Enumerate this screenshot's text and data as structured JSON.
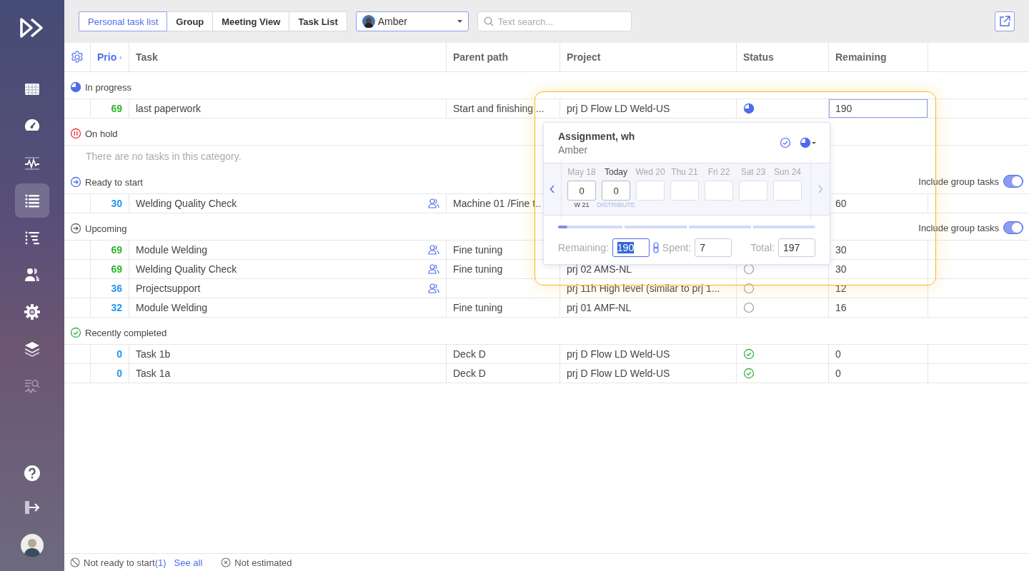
{
  "sidebar": {
    "items": [
      {
        "kind": "grid",
        "selected": false,
        "disabled": false
      },
      {
        "kind": "gauge",
        "selected": false,
        "disabled": false
      },
      {
        "kind": "pulse",
        "selected": false,
        "disabled": false
      },
      {
        "kind": "list",
        "selected": true,
        "disabled": false
      },
      {
        "kind": "tree",
        "selected": false,
        "disabled": false
      },
      {
        "kind": "people",
        "selected": false,
        "disabled": false
      },
      {
        "kind": "gear",
        "selected": false,
        "disabled": false
      },
      {
        "kind": "layers",
        "selected": false,
        "disabled": false
      },
      {
        "kind": "search_pulse",
        "selected": false,
        "disabled": true
      }
    ],
    "bottom_items": [
      {
        "kind": "help"
      },
      {
        "kind": "logout"
      },
      {
        "kind": "avatar"
      }
    ]
  },
  "toolbar": {
    "tabs": [
      {
        "label": "Personal task list",
        "selected": true
      },
      {
        "label": "Group",
        "selected": false
      },
      {
        "label": "Meeting View",
        "selected": false
      },
      {
        "label": "Task List",
        "selected": false
      }
    ],
    "user_select": {
      "value": "Amber"
    },
    "search": {
      "placeholder": "Text search..."
    }
  },
  "table": {
    "columns": [
      {
        "label": "Prio",
        "sorted": true
      },
      {
        "label": "Task",
        "sorted": false
      },
      {
        "label": "Parent path",
        "sorted": false
      },
      {
        "label": "Project",
        "sorted": false
      },
      {
        "label": "Status",
        "sorted": false
      },
      {
        "label": "Remaining",
        "sorted": false
      }
    ],
    "groups": [
      {
        "kind": "in_progress",
        "title": "In progress",
        "rows": [
          {
            "prio": "69",
            "color": "#2db52d",
            "task": "last paperwork",
            "group_task": false,
            "parent_path": "Start and finishing ...",
            "project": "prj D Flow LD Weld-US",
            "kind": "in_progress",
            "remaining": "190",
            "editing": true
          }
        ]
      },
      {
        "kind": "on_hold",
        "title": "On hold",
        "empty_text": "There are no tasks in this category."
      },
      {
        "kind": "ready",
        "title": "Ready to start",
        "toggle": {
          "label": "Include group tasks",
          "on": true
        },
        "rows": [
          {
            "prio": "30",
            "color": "#2196f3",
            "task": "Welding Quality Check",
            "group_task": true,
            "parent_path": "Machine 01 /Fine t..",
            "remaining": "60",
            "editing": false
          }
        ]
      },
      {
        "kind": "upcoming",
        "title": "Upcoming",
        "toggle": {
          "label": "Include group tasks",
          "on": true
        },
        "rows": [
          {
            "prio": "69",
            "color": "#2db52d",
            "task": "Module Welding",
            "group_task": true,
            "parent_path": "Fine tuning",
            "remaining": "30",
            "editing": false
          },
          {
            "prio": "69",
            "color": "#2db52d",
            "task": "Welding Quality Check",
            "group_task": true,
            "parent_path": "Fine tuning",
            "project": "prj 02 AMS-NL",
            "kind": "todo",
            "remaining": "30",
            "editing": false
          },
          {
            "prio": "36",
            "color": "#2196f3",
            "task": "Projectsupport",
            "group_task": true,
            "project": "prj 11h High level (similar to prj 1...",
            "kind": "todo",
            "remaining": "12",
            "editing": false
          },
          {
            "prio": "32",
            "color": "#2196f3",
            "task": "Module Welding",
            "group_task": false,
            "parent_path": "Fine tuning",
            "project": "prj 01 AMF-NL",
            "kind": "todo",
            "remaining": "16",
            "editing": false
          }
        ]
      },
      {
        "kind": "completed",
        "title": "Recently completed",
        "rows": [
          {
            "prio": "0",
            "color": "#2196f3",
            "task": "Task 1b",
            "group_task": false,
            "parent_path": "Deck D",
            "project": "prj D Flow LD Weld-US",
            "kind": "done",
            "remaining": "0",
            "editing": false
          },
          {
            "prio": "0",
            "color": "#2196f3",
            "task": "Task 1a",
            "group_task": false,
            "parent_path": "Deck D",
            "project": "prj D Flow LD Weld-US",
            "kind": "done",
            "remaining": "0",
            "editing": false
          }
        ]
      }
    ]
  },
  "popup": {
    "title": "Assignment, wh",
    "subtitle": "Amber",
    "days": [
      {
        "label": "May 18",
        "value": "0",
        "today": false,
        "week": "W 21"
      },
      {
        "label": "Today",
        "value": "0",
        "today": true,
        "action": "DISTRIBUTE"
      },
      {
        "label": "Wed 20",
        "today": false
      },
      {
        "label": "Thu 21",
        "today": false
      },
      {
        "label": "Fri 22",
        "today": false
      },
      {
        "label": "Sat 23",
        "today": false
      },
      {
        "label": "Sun 24",
        "today": false
      }
    ],
    "level": 0.035,
    "remaining_label": "Remaining:",
    "remaining": "190",
    "remaining_selected": true,
    "spent_label": "Spent:",
    "spent": "7",
    "total_label": "Total:",
    "total": "197"
  },
  "footer": {
    "items": [
      {
        "kind": "not_ready",
        "label": "Not ready to start",
        "count": "(1)",
        "link": "See all"
      },
      {
        "kind": "not_estimated",
        "label": "Not estimated"
      }
    ]
  }
}
